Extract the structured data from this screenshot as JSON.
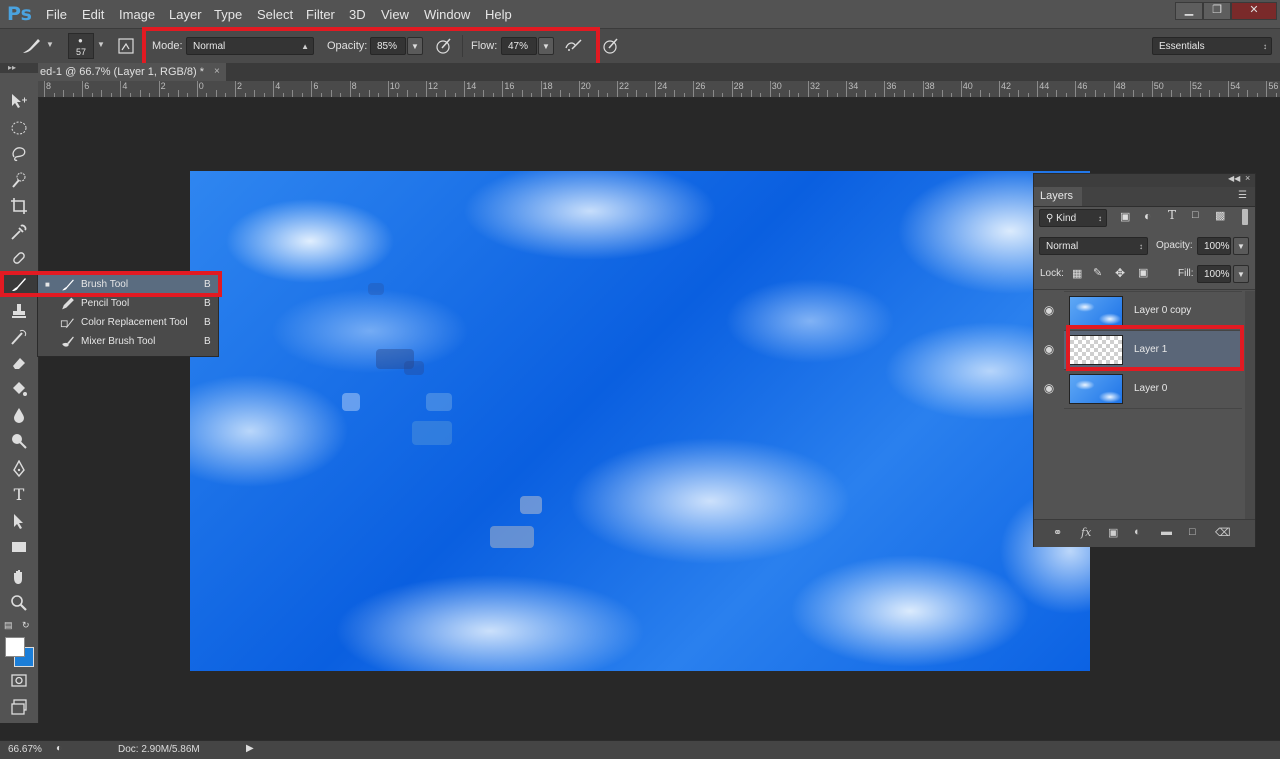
{
  "app": {
    "logo": "Ps"
  },
  "menu": [
    "File",
    "Edit",
    "Image",
    "Layer",
    "Type",
    "Select",
    "Filter",
    "3D",
    "View",
    "Window",
    "Help"
  ],
  "window_controls": {
    "minimize": "▁",
    "restore": "❐",
    "close": "✕"
  },
  "options": {
    "brush_size": "57",
    "mode_label": "Mode:",
    "mode_value": "Normal",
    "opacity_label": "Opacity:",
    "opacity_value": "85%",
    "flow_label": "Flow:",
    "flow_value": "47%",
    "workspace": "Essentials"
  },
  "document": {
    "tab_title": "ed-1 @ 66.7% (Layer 1, RGB/8) *"
  },
  "ruler": {
    "ticks": [
      "8",
      "6",
      "4",
      "2",
      "0",
      "2",
      "4",
      "6",
      "8",
      "10",
      "12",
      "14",
      "16",
      "18",
      "20",
      "22",
      "24",
      "26",
      "28",
      "30",
      "32",
      "34",
      "36",
      "38",
      "40",
      "42",
      "44",
      "46",
      "48",
      "50",
      "52",
      "54",
      "56"
    ]
  },
  "flyout": {
    "items": [
      {
        "label": "Brush Tool",
        "key": "B",
        "selected": true
      },
      {
        "label": "Pencil Tool",
        "key": "B",
        "selected": false
      },
      {
        "label": "Color Replacement Tool",
        "key": "B",
        "selected": false
      },
      {
        "label": "Mixer Brush Tool",
        "key": "B",
        "selected": false
      }
    ]
  },
  "layers_panel": {
    "tab": "Layers",
    "filter_kind": "Kind",
    "blend_mode": "Normal",
    "opacity_label": "Opacity:",
    "opacity_value": "100%",
    "lock_label": "Lock:",
    "fill_label": "Fill:",
    "fill_value": "100%",
    "layers": [
      {
        "name": "Layer 0 copy",
        "thumb": "sky",
        "selected": false
      },
      {
        "name": "Layer 1",
        "thumb": "transparent",
        "selected": true
      },
      {
        "name": "Layer 0",
        "thumb": "sky",
        "selected": false
      }
    ]
  },
  "status": {
    "zoom": "66.67%",
    "doc": "Doc: 2.90M/5.86M"
  },
  "colors": {
    "accent_red": "#e21a22",
    "canvas_blue": "#1a6fe8",
    "ps_blue": "#4aa3e0"
  }
}
